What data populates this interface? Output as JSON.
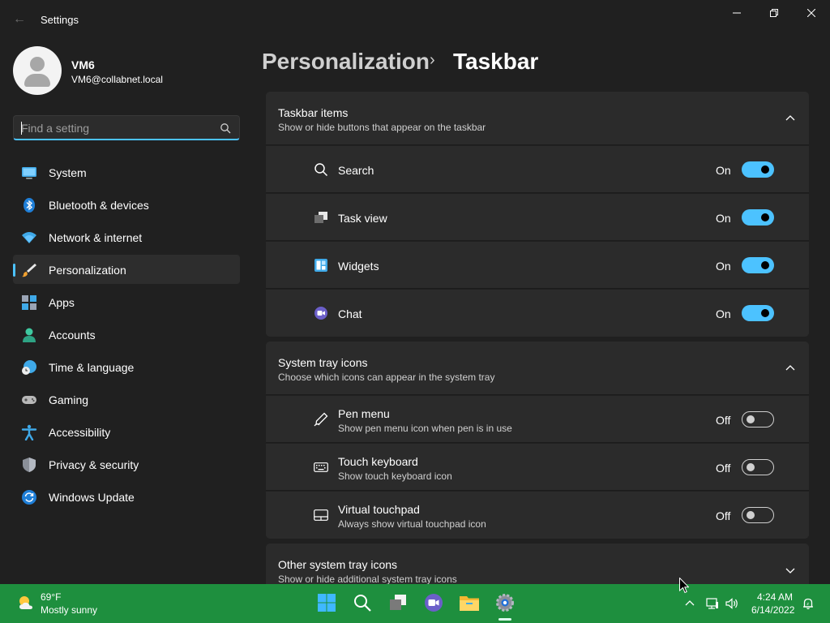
{
  "window": {
    "title": "Settings"
  },
  "profile": {
    "name": "VM6",
    "email": "VM6@collabnet.local"
  },
  "search": {
    "placeholder": "Find a setting"
  },
  "nav": [
    {
      "label": "System",
      "icon": "system-icon"
    },
    {
      "label": "Bluetooth & devices",
      "icon": "bluetooth-icon"
    },
    {
      "label": "Network & internet",
      "icon": "wifi-icon"
    },
    {
      "label": "Personalization",
      "icon": "brush-icon",
      "active": true
    },
    {
      "label": "Apps",
      "icon": "apps-icon"
    },
    {
      "label": "Accounts",
      "icon": "accounts-icon"
    },
    {
      "label": "Time & language",
      "icon": "globe-clock-icon"
    },
    {
      "label": "Gaming",
      "icon": "gamepad-icon"
    },
    {
      "label": "Accessibility",
      "icon": "accessibility-icon"
    },
    {
      "label": "Privacy & security",
      "icon": "shield-icon"
    },
    {
      "label": "Windows Update",
      "icon": "update-icon"
    }
  ],
  "header": {
    "parent": "Personalization",
    "separator": "›",
    "current": "Taskbar"
  },
  "sections": {
    "taskbar_items": {
      "title": "Taskbar items",
      "subtitle": "Show or hide buttons that appear on the taskbar",
      "rows": [
        {
          "label": "Search",
          "state": "On",
          "icon": "search-icon"
        },
        {
          "label": "Task view",
          "state": "On",
          "icon": "task-view-icon"
        },
        {
          "label": "Widgets",
          "state": "On",
          "icon": "widgets-icon"
        },
        {
          "label": "Chat",
          "state": "On",
          "icon": "chat-icon"
        }
      ]
    },
    "system_tray": {
      "title": "System tray icons",
      "subtitle": "Choose which icons can appear in the system tray",
      "rows": [
        {
          "label": "Pen menu",
          "sub": "Show pen menu icon when pen is in use",
          "state": "Off",
          "icon": "pen-icon"
        },
        {
          "label": "Touch keyboard",
          "sub": "Show touch keyboard icon",
          "state": "Off",
          "icon": "keyboard-icon"
        },
        {
          "label": "Virtual touchpad",
          "sub": "Always show virtual touchpad icon",
          "state": "Off",
          "icon": "touchpad-icon"
        }
      ]
    },
    "other_tray": {
      "title": "Other system tray icons",
      "subtitle": "Show or hide additional system tray icons"
    }
  },
  "taskbar": {
    "weather": {
      "temp": "69°F",
      "condition": "Mostly sunny"
    },
    "clock": {
      "time": "4:24 AM",
      "date": "6/14/2022"
    }
  },
  "colors": {
    "accent": "#4cc2ff",
    "taskbar": "#1e8f3e",
    "background": "#202020",
    "card": "#2b2b2b"
  }
}
